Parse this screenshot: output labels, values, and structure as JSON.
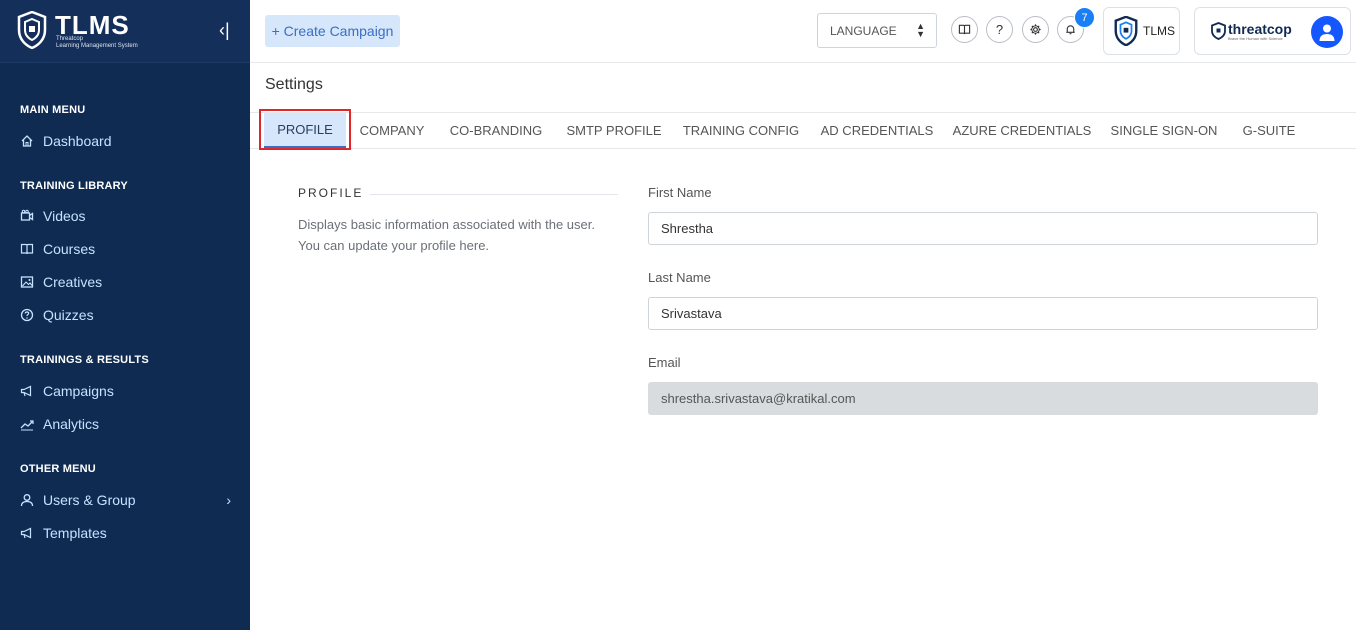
{
  "brand": {
    "name": "TLMS",
    "subtitle_line1": "Threatcop",
    "subtitle_line2": "Learning Management System",
    "collapse_glyph": "‹|"
  },
  "sidebar": {
    "sections": [
      {
        "title": "MAIN MENU",
        "items": [
          {
            "label": "Dashboard",
            "icon": "home-icon"
          }
        ]
      },
      {
        "title": "TRAINING LIBRARY",
        "items": [
          {
            "label": "Videos",
            "icon": "video-icon"
          },
          {
            "label": "Courses",
            "icon": "book-icon"
          },
          {
            "label": "Creatives",
            "icon": "image-icon"
          },
          {
            "label": "Quizzes",
            "icon": "question-icon"
          }
        ]
      },
      {
        "title": "TRAININGS & RESULTS",
        "items": [
          {
            "label": "Campaigns",
            "icon": "megaphone-icon"
          },
          {
            "label": "Analytics",
            "icon": "chart-icon"
          }
        ]
      },
      {
        "title": "OTHER MENU",
        "items": [
          {
            "label": "Users & Group",
            "icon": "user-icon",
            "chevron": "›"
          },
          {
            "label": "Templates",
            "icon": "megaphone-icon"
          }
        ]
      }
    ]
  },
  "header": {
    "create_campaign_label": "+ Create Campaign",
    "language_label": "LANGUAGE",
    "notification_count": "7",
    "tlms_card_label": "TLMS",
    "threatcop_label": "threatcop",
    "threatcop_tagline": "Brave the Human with Science",
    "help_glyph": "?"
  },
  "page": {
    "title": "Settings",
    "tabs": [
      {
        "label": "PROFILE",
        "active": true
      },
      {
        "label": "COMPANY"
      },
      {
        "label": "CO-BRANDING"
      },
      {
        "label": "SMTP PROFILE"
      },
      {
        "label": "TRAINING CONFIG"
      },
      {
        "label": "AD CREDENTIALS"
      },
      {
        "label": "AZURE CREDENTIALS"
      },
      {
        "label": "SINGLE SIGN-ON"
      },
      {
        "label": "G-SUITE"
      }
    ]
  },
  "profile": {
    "section_title": "PROFILE",
    "description": "Displays basic information associated with the user. You can update your profile here.",
    "first_name_label": "First Name",
    "first_name_value": "Shrestha",
    "last_name_label": "Last Name",
    "last_name_value": "Srivastava",
    "email_label": "Email",
    "email_value": "shrestha.srivastava@kratikal.com"
  },
  "colors": {
    "sidebar_bg": "#0f2b52",
    "accent": "#3a6fc4",
    "active_tab_bg": "#d6e6fb",
    "highlight_red": "#e0262b",
    "badge_blue": "#1a7ff5"
  }
}
